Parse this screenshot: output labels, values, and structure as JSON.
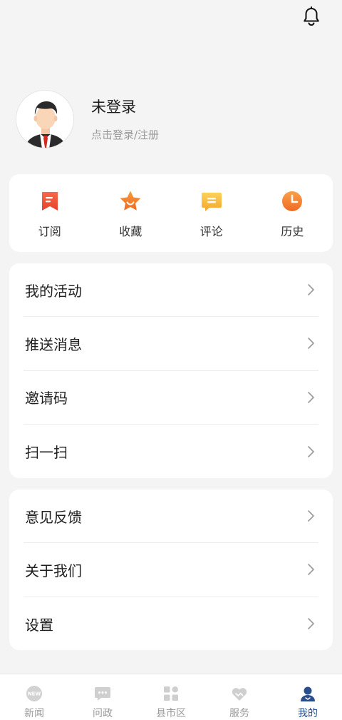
{
  "user": {
    "name": "未登录",
    "login_hint": "点击登录/注册"
  },
  "quick_actions": [
    {
      "label": "订阅",
      "icon": "subscribe-icon",
      "color": "#f05a3c"
    },
    {
      "label": "收藏",
      "icon": "star-icon",
      "color": "#f5822a"
    },
    {
      "label": "评论",
      "icon": "comment-icon",
      "color": "#f6b93b"
    },
    {
      "label": "历史",
      "icon": "clock-icon",
      "color": "#f5822a"
    }
  ],
  "menu_group_1": [
    {
      "label": "我的活动"
    },
    {
      "label": "推送消息"
    },
    {
      "label": "邀请码"
    },
    {
      "label": "扫一扫"
    }
  ],
  "menu_group_2": [
    {
      "label": "意见反馈"
    },
    {
      "label": "关于我们"
    },
    {
      "label": "设置"
    }
  ],
  "tabbar": [
    {
      "label": "新闻",
      "icon": "news-icon",
      "active": false
    },
    {
      "label": "问政",
      "icon": "chat-icon",
      "active": false
    },
    {
      "label": "县市区",
      "icon": "grid-icon",
      "active": false
    },
    {
      "label": "服务",
      "icon": "heart-handshake-icon",
      "active": false
    },
    {
      "label": "我的",
      "icon": "user-icon",
      "active": true
    }
  ],
  "colors": {
    "active_tab": "#2a4e8a",
    "inactive_tab": "#c8c8c8"
  }
}
